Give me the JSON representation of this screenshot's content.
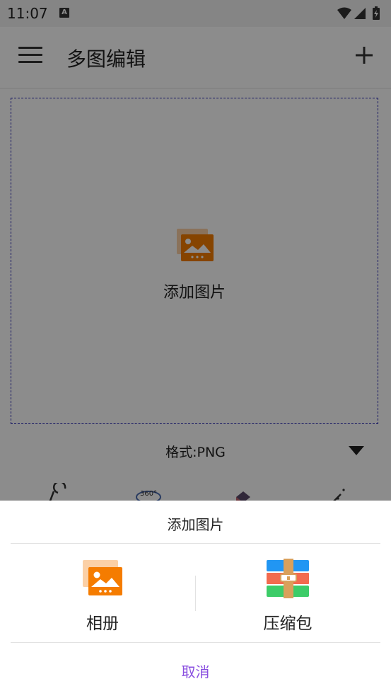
{
  "status_bar": {
    "time": "11:07",
    "notification_badge": "A"
  },
  "app_bar": {
    "title": "多图编辑"
  },
  "canvas": {
    "add_image_label": "添加图片"
  },
  "format": {
    "label": "格式:PNG"
  },
  "sheet": {
    "title": "添加图片",
    "options": [
      {
        "label": "相册",
        "icon": "album-icon"
      },
      {
        "label": "压缩包",
        "icon": "archive-icon"
      }
    ],
    "cancel_label": "取消"
  },
  "colors": {
    "accent": "#8a4fe0",
    "image_icon_orange": "#f57c00",
    "dashed_border": "#2b2bb5"
  }
}
